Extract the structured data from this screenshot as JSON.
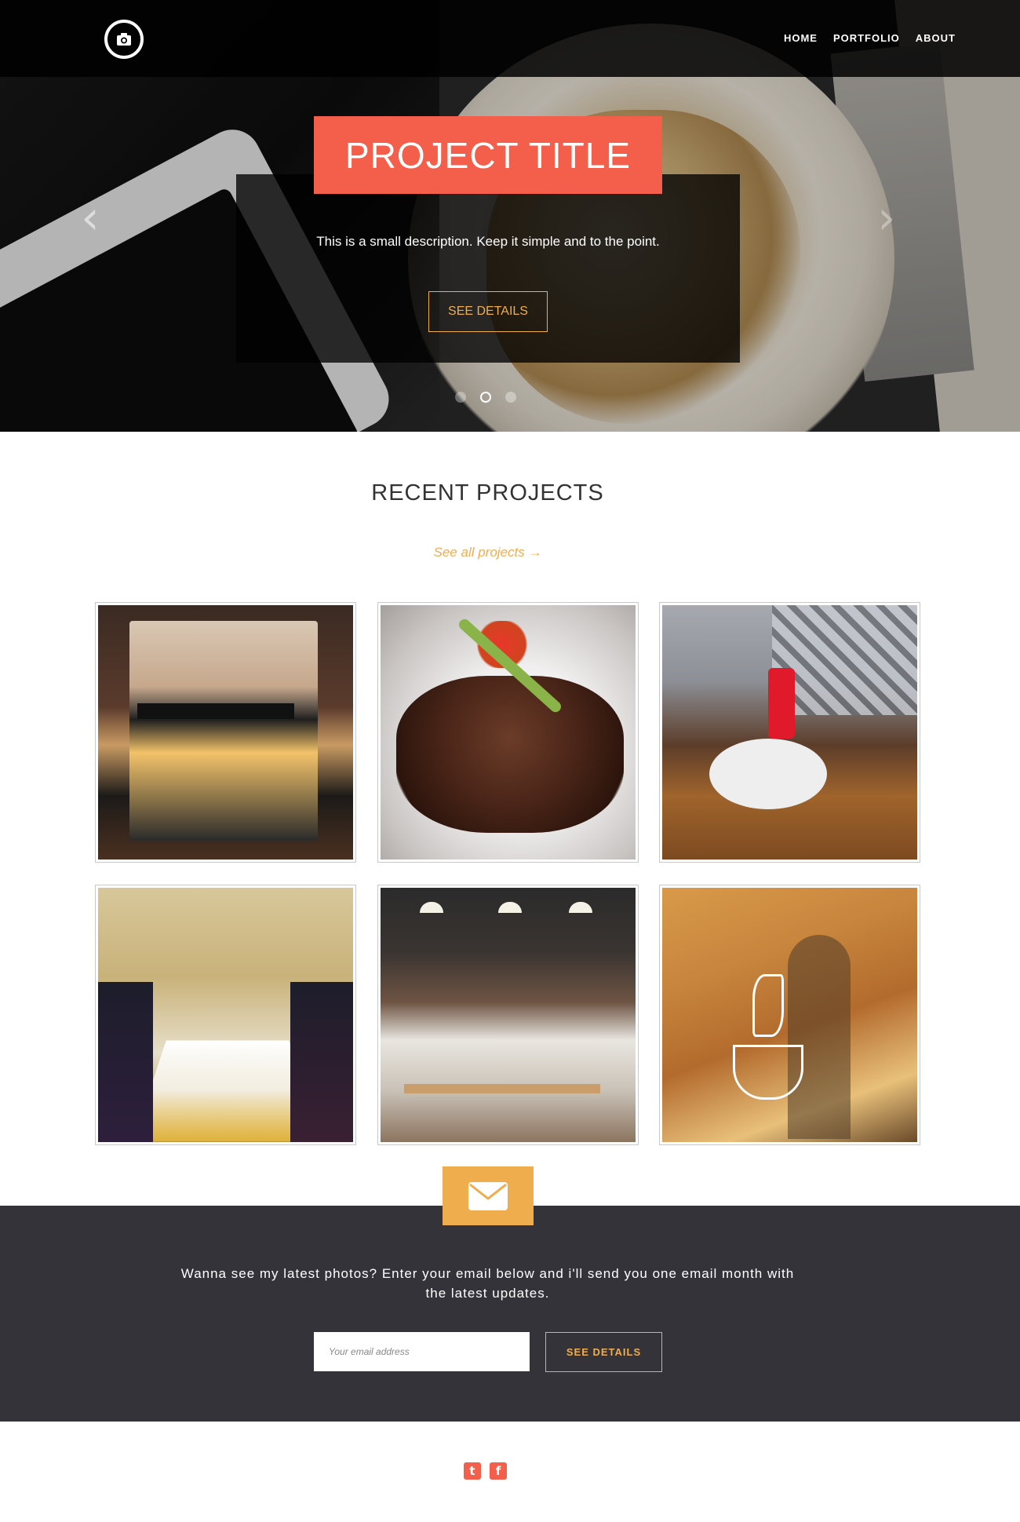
{
  "nav": {
    "items": [
      "HOME",
      "PORTFOLIO",
      "ABOUT"
    ]
  },
  "hero": {
    "title": "PROJECT TITLE",
    "description": "This is a small description. Keep it simple and to the point.",
    "button_label": "SEE DETAILS",
    "prev_icon": "‹",
    "next_icon": "›",
    "slides_count": 3,
    "active_slide": 2
  },
  "projects": {
    "title": "RECENT PROJECTS",
    "see_all": "See all projects →"
  },
  "newsletter": {
    "text": "Wanna see my latest photos? Enter your email below and i'll send you one email month with the latest updates.",
    "input_placeholder": "Your email address",
    "button_label": "SEE DETAILS"
  },
  "social": {
    "twitter_icon": "t",
    "facebook_icon": "f"
  },
  "colors": {
    "accent": "#f0ad4e",
    "title_bg": "#f35f4b",
    "dark": "#333339"
  }
}
